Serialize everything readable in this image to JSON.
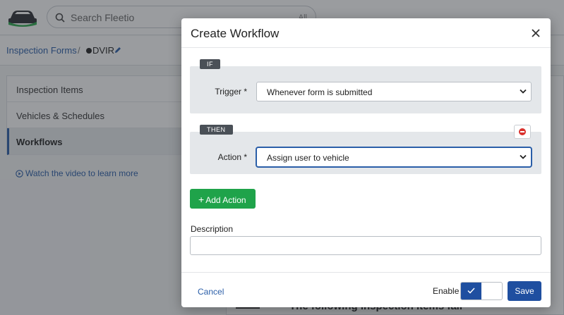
{
  "app": {
    "search_placeholder": "Search Fleetio",
    "search_scope": "All",
    "breadcrumb": {
      "parent": "Inspection Forms",
      "separator": "/",
      "current": "DVIR"
    },
    "sidebar": {
      "items": [
        {
          "label": "Inspection Items"
        },
        {
          "label": "Vehicles & Schedules"
        },
        {
          "label": "Workflows"
        }
      ],
      "video_link": "Watch the video to learn more"
    },
    "footer_heading": "The following inspection items fail"
  },
  "modal": {
    "title": "Create Workflow",
    "if_tag": "IF",
    "then_tag": "THEN",
    "trigger_label": "Trigger *",
    "trigger_value": "Whenever form is submitted",
    "action_label": "Action *",
    "action_value": "Assign user to vehicle",
    "add_action_label": "Add Action",
    "description_label": "Description",
    "description_value": "",
    "cancel_label": "Cancel",
    "enable_label": "Enable",
    "enable_state": true,
    "save_label": "Save"
  },
  "colors": {
    "primary": "#1f4fa0",
    "link": "#2a5ea8",
    "success": "#1fa34a",
    "danger": "#d9312d"
  }
}
